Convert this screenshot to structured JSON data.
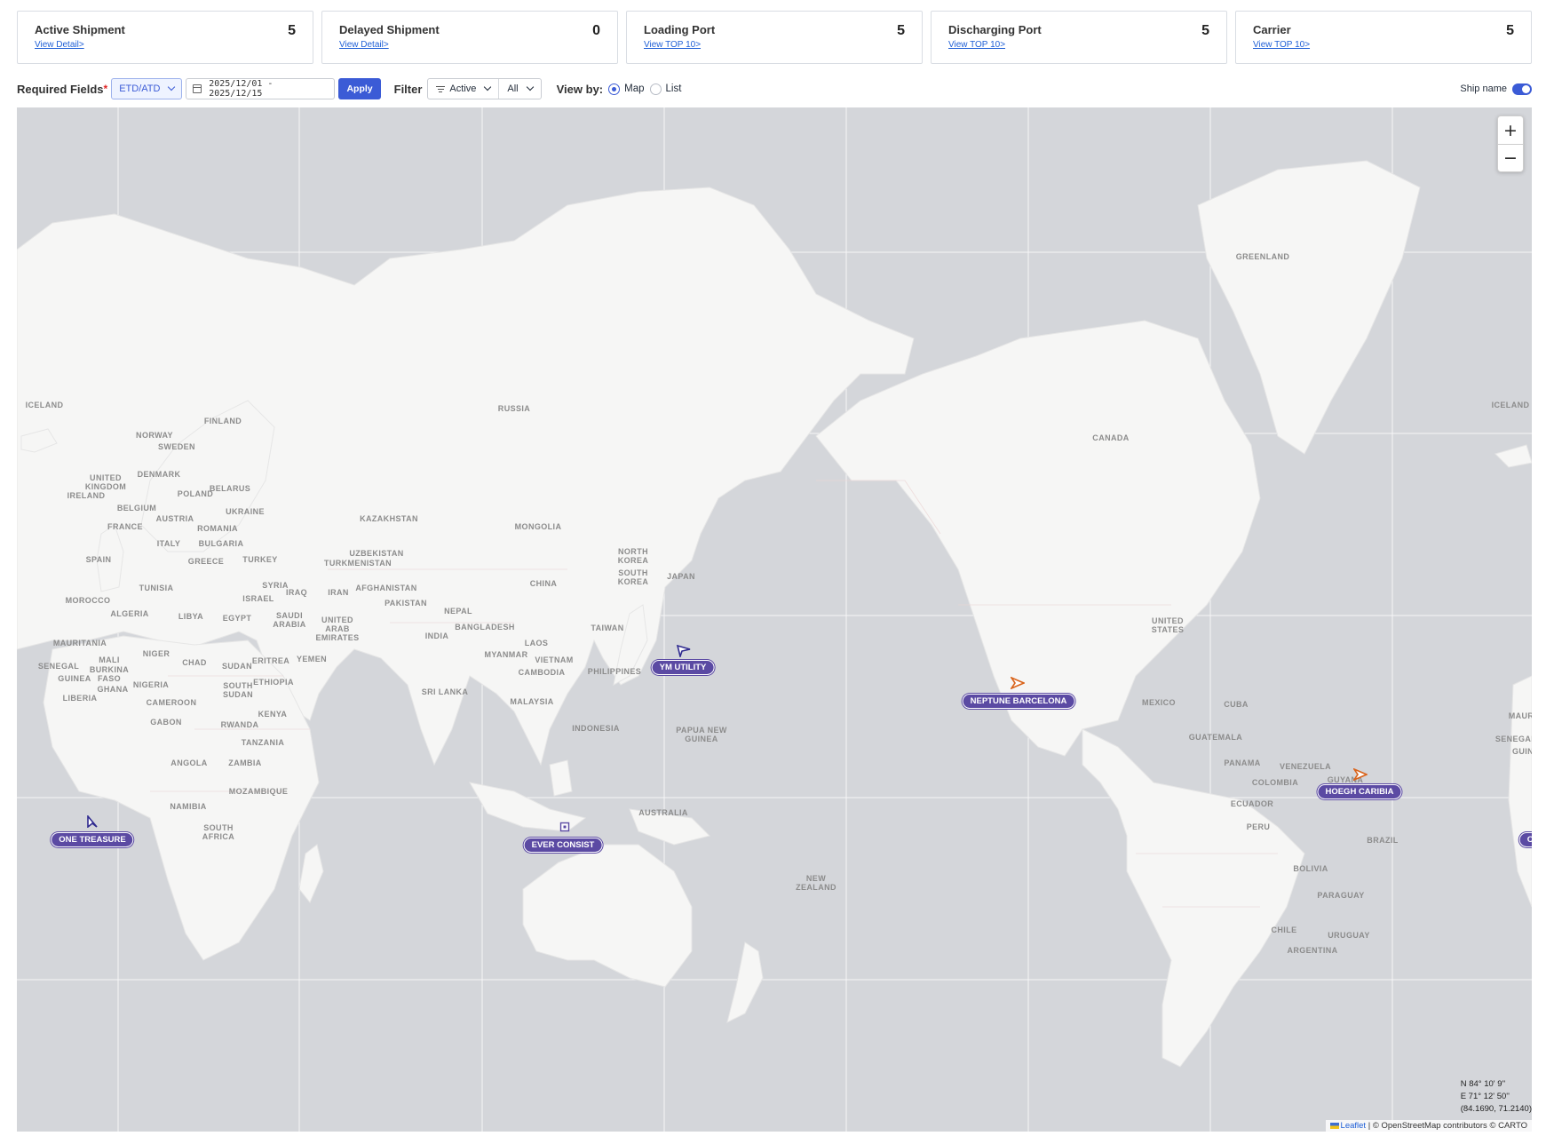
{
  "cards": [
    {
      "title": "Active Shipment",
      "count": "5",
      "link": "View Detail>"
    },
    {
      "title": "Delayed Shipment",
      "count": "0",
      "link": "View Detail>"
    },
    {
      "title": "Loading Port",
      "count": "5",
      "link": "View TOP 10>"
    },
    {
      "title": "Discharging Port",
      "count": "5",
      "link": "View TOP 10>"
    },
    {
      "title": "Carrier",
      "count": "5",
      "link": "View TOP 10>"
    }
  ],
  "toolbar": {
    "required_label": "Required Fields",
    "required_mark": "*",
    "date_type": "ETD/ATD",
    "date_range": "2025/12/01 - 2025/12/15",
    "apply_label": "Apply",
    "filter_label": "Filter",
    "status_filter": "Active",
    "scope_filter": "All",
    "view_label": "View by:",
    "view_options": [
      "Map",
      "List"
    ],
    "view_selected": "Map",
    "ship_name_label": "Ship name",
    "ship_name_on": true,
    "accent": "#3b5bd6"
  },
  "map": {
    "zoom_in": "+",
    "zoom_out": "−",
    "coords": {
      "lat_dms": "N 84° 10' 9''",
      "lon_dms": "E 71° 12' 50''",
      "decimal": "(84.1690, 71.2140)"
    },
    "attribution": {
      "leaflet": "Leaflet",
      "rest": " | © OpenStreetMap contributors © CARTO"
    },
    "labels": {
      "greenland": "GREENLAND",
      "iceland_w": "ICELAND",
      "iceland_e": "ICELAND",
      "russia": "RUSSIA",
      "finland": "FINLAND",
      "norway": "NORWAY",
      "sweden": "SWEDEN",
      "denmark": "DENMARK",
      "uk": "UNITED\nKINGDOM",
      "ireland": "IRELAND",
      "belgium": "BELGIUM",
      "poland": "POLAND",
      "belarus": "BELARUS",
      "ukraine": "UKRAINE",
      "france": "FRANCE",
      "austria": "AUSTRIA",
      "romania": "ROMANIA",
      "italy": "ITALY",
      "bulgaria": "BULGARIA",
      "spain": "SPAIN",
      "greece": "GREECE",
      "turkey": "TURKEY",
      "kazakhstan": "KAZAKHSTAN",
      "uzbekistan": "UZBEKISTAN",
      "turkmenistan": "TURKMENISTAN",
      "mongolia": "MONGOLIA",
      "north_korea": "NORTH\nKOREA",
      "south_korea": "SOUTH\nKOREA",
      "japan": "JAPAN",
      "china": "CHINA",
      "syria": "SYRIA",
      "iraq": "IRAQ",
      "iran": "IRAN",
      "afghanistan": "AFGHANISTAN",
      "pakistan": "PAKISTAN",
      "nepal": "NEPAL",
      "tunisia": "TUNISIA",
      "morocco": "MOROCCO",
      "algeria": "ALGERIA",
      "libya": "LIBYA",
      "egypt": "EGYPT",
      "israel": "ISRAEL",
      "saudi": "SAUDI\nARABIA",
      "uae": "UNITED\nARAB\nEMIRATES",
      "india": "INDIA",
      "bangladesh": "BANGLADESH",
      "taiwan": "TAIWAN",
      "laos": "LAOS",
      "myanmar": "MYANMAR",
      "vietnam": "VIETNAM",
      "cambodia": "CAMBODIA",
      "philippines": "PHILIPPINES",
      "mauritania": "MAURITANIA",
      "mali": "MALI",
      "niger": "NIGER",
      "chad": "CHAD",
      "sudan": "SUDAN",
      "eritrea": "ERITREA",
      "yemen": "YEMEN",
      "senegal": "SENEGAL",
      "guinea": "GUINEA",
      "burkina": "BURKINA\nFASO",
      "ghana": "GHANA",
      "nigeria": "NIGERIA",
      "ethiopia": "ETHIOPIA",
      "south_sudan": "SOUTH\nSUDAN",
      "liberia": "LIBERIA",
      "cameroon": "CAMEROON",
      "kenya": "KENYA",
      "gabon": "GABON",
      "rwanda": "RWANDA",
      "tanzania": "TANZANIA",
      "angola": "ANGOLA",
      "zambia": "ZAMBIA",
      "mozambique": "MOZAMBIQUE",
      "namibia": "NAMIBIA",
      "south_africa": "SOUTH\nAFRICA",
      "sri_lanka": "SRI LANKA",
      "malaysia": "MALAYSIA",
      "indonesia": "INDONESIA",
      "png": "PAPUA NEW\nGUINEA",
      "australia": "AUSTRALIA",
      "new_zealand": "NEW\nZEALAND",
      "canada": "CANADA",
      "united_states": "UNITED\nSTATES",
      "mexico": "MEXICO",
      "cuba": "CUBA",
      "guatemala": "GUATEMALA",
      "panama": "PANAMA",
      "venezuela": "VENEZUELA",
      "guyana": "GUYANA",
      "colombia": "COLOMBIA",
      "ecuador": "ECUADOR",
      "peru": "PERU",
      "brazil": "BRAZIL",
      "bolivia": "BOLIVIA",
      "paraguay": "PARAGUAY",
      "chile": "CHILE",
      "uruguay": "URUGUAY",
      "argentina": "ARGENTINA",
      "maur_edge": "MAUR",
      "senegal_edge": "SENEGAL",
      "guin_edge": "GUIN"
    },
    "ships": [
      {
        "name": "YM UTILITY",
        "color": "#2f2a8f",
        "marker": "arrow"
      },
      {
        "name": "NEPTUNE BARCELONA",
        "color": "#d9641c",
        "marker": "arrow"
      },
      {
        "name": "HOEGH CARIBIA",
        "color": "#d9641c",
        "marker": "arrow"
      },
      {
        "name": "ONE TREASURE",
        "color": "#2f2a8f",
        "marker": "arrow"
      },
      {
        "name": "EVER CONSIST",
        "color": "#5b4aa3",
        "marker": "square"
      },
      {
        "name": "ONE",
        "color": "#5b4aa3",
        "marker": "none"
      }
    ]
  }
}
